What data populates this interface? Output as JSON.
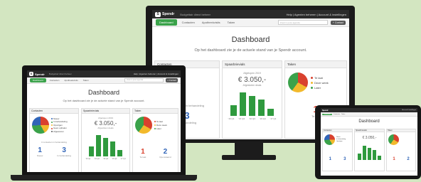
{
  "app": {
    "logo": "Spendr",
    "tagline": "Budgettair direct beheer",
    "help": "Help",
    "agent": "Agenten beheren",
    "account": "Account & instellingen"
  },
  "nav": {
    "tabs": [
      "Dashboard",
      "Contacten",
      "Apotheekvisits",
      "Taken"
    ],
    "search_placeholder": "Zoek in jouw agenda",
    "button": "+ Contact"
  },
  "page": {
    "title": "Dashboard",
    "subtitle": "Op het dashboard zie je de actuele stand van je Spendr account."
  },
  "contacts": {
    "title": "Contacten",
    "legend": [
      "Nieuw",
      "In behandeling",
      "Opvolgen",
      "Geen ophalen",
      "Afgewezen"
    ],
    "note": "contacten in behandeling",
    "stats": [
      {
        "value": "1",
        "label": "Nieuw"
      },
      {
        "value": "3",
        "label": "In behandeling"
      }
    ]
  },
  "spend": {
    "title": "Spaarbrievials",
    "period": "Afgelopen 2019",
    "amount": "€ 3.050,-",
    "amount_sub": "Afgesloten deals",
    "bar_values": [
      0.45,
      1.0,
      0.85,
      0.7,
      0.3
    ],
    "bar_labels": [
      "'16 Q1",
      "'16 Q2",
      "'16 Q3",
      "'16 Q4",
      "'17 Q1"
    ]
  },
  "tasks": {
    "title": "Taken",
    "legend": [
      "Te laat",
      "Deze week",
      "Later"
    ],
    "stats": [
      {
        "value": "1",
        "label": "Te laat"
      },
      {
        "value": "2",
        "label": "Openstaand"
      }
    ]
  },
  "colors": {
    "accent": "#3aa24a",
    "blue": "#3064b8",
    "red": "#d9412e",
    "yellow": "#f2b92c"
  }
}
